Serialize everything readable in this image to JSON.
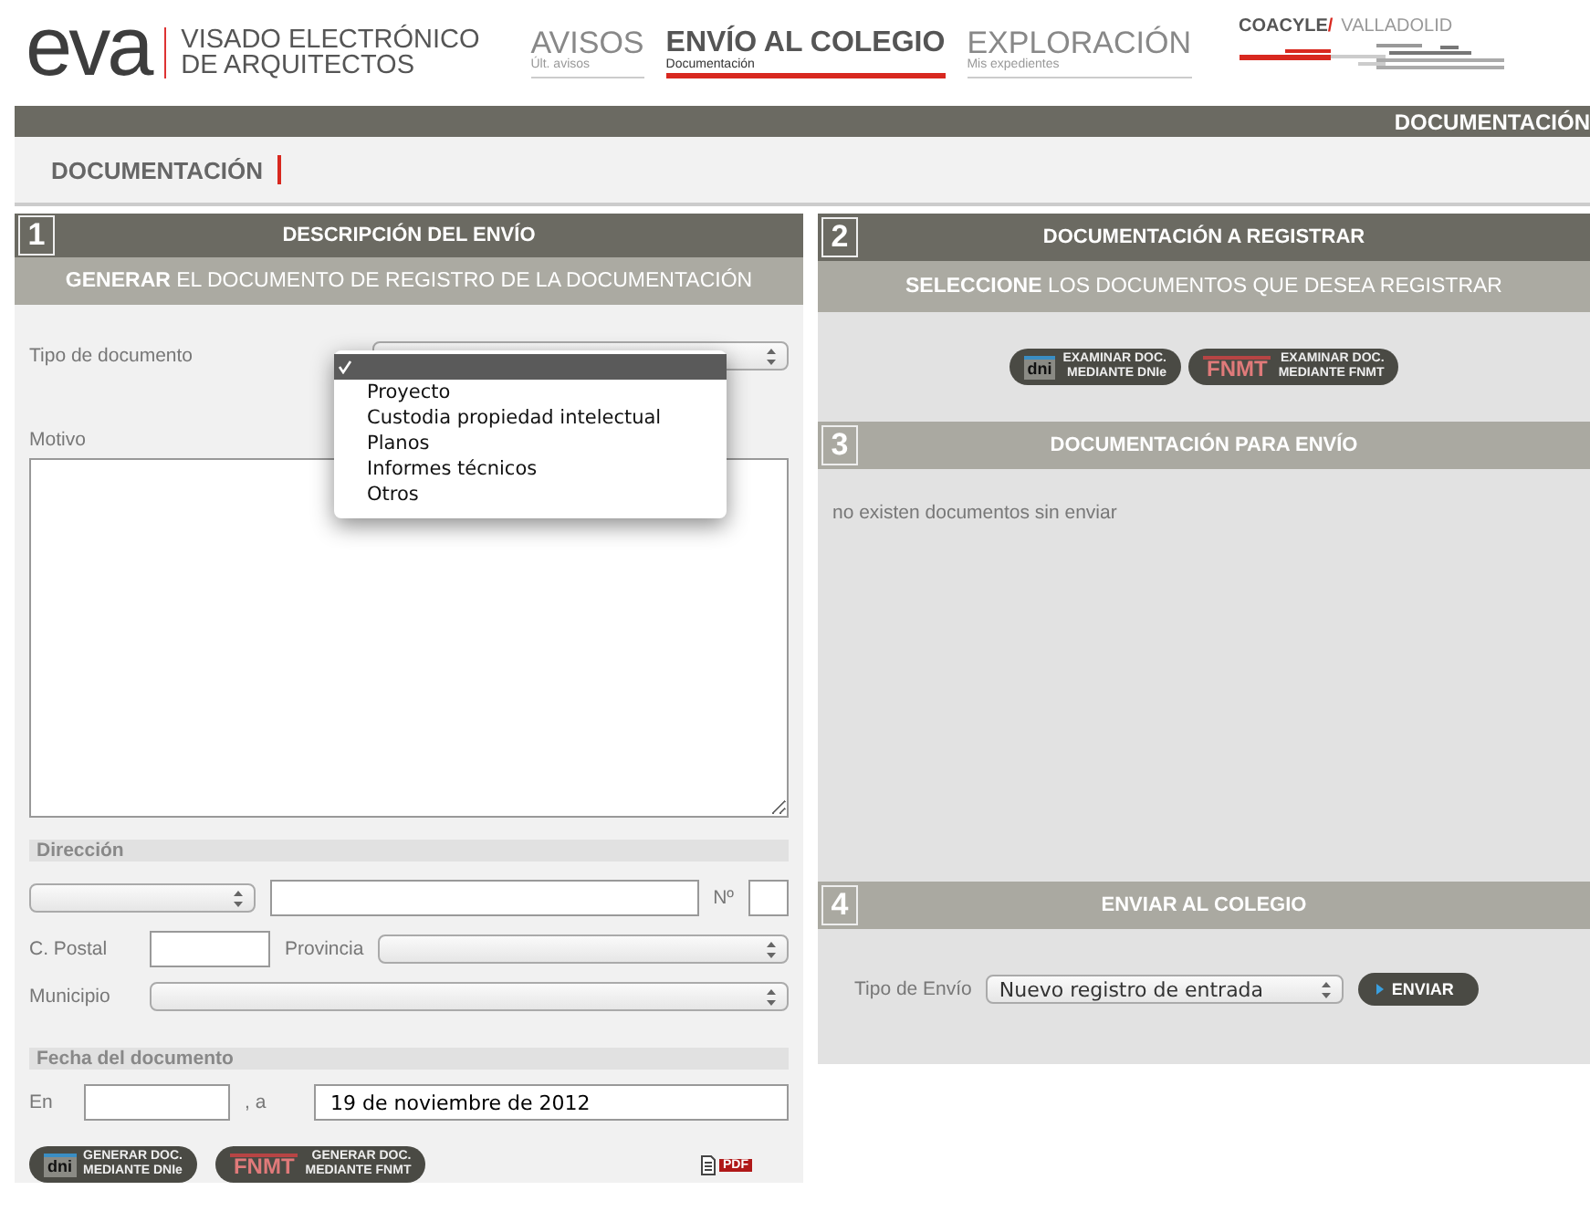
{
  "header": {
    "logo": "eva",
    "tagline": [
      "VISADO ELECTRÓNICO",
      "DE ARQUITECTOS"
    ],
    "nav": [
      {
        "title": "AVISOS",
        "subtitle": "Últ. avisos",
        "selected": false
      },
      {
        "title": "ENVÍO AL COLEGIO",
        "subtitle": "Documentación",
        "selected": true
      },
      {
        "title": "EXPLORACIÓN",
        "subtitle": "Mis expedientes",
        "selected": false
      }
    ],
    "college": {
      "name": "COACYLE/",
      "city": "VALLADOLID"
    }
  },
  "breadcrumb_bar": "DOCUMENTACIÓN",
  "page_title": "DOCUMENTACIÓN",
  "left_panel": {
    "number": "1",
    "title": "DESCRIPCIÓN DEL ENVÍO",
    "kind": "dark",
    "subtitle": "**GENERAR** EL DOCUMENTO DE REGISTRO DE LA DOCUMENTACIÓN",
    "doc_type": {
      "label": "Tipo de documento",
      "options": [
        {
          "selected": true
        },
        {
          "label": "Proyecto",
          "selected": false
        },
        {
          "label": "Custodia propiedad intelectual",
          "selected": false
        },
        {
          "label": "Planos",
          "selected": false
        },
        {
          "label": "Informes técnicos",
          "selected": false
        },
        {
          "label": "Otros",
          "selected": false
        }
      ]
    },
    "motivo": {
      "label": "Motivo"
    },
    "address": {
      "title": "Dirección",
      "number_label": "Nº",
      "postal_label": "C. Postal",
      "province_label": "Provincia",
      "municipality_label": "Municipio"
    },
    "date": {
      "title": "Fecha del documento",
      "place_label": "En",
      "date_label": ", a",
      "value": "19 de noviembre de 2012"
    },
    "buttons": [
      {
        "kind": "dnie",
        "logo": "dni",
        "lines": [
          "GENERAR DOC.",
          "MEDIANTE DNIe"
        ]
      },
      {
        "kind": "fnmt",
        "logo": "FNMT",
        "lines": [
          "GENERAR DOC.",
          "MEDIANTE FNMT"
        ]
      }
    ],
    "pdf_label": "PDF"
  },
  "right_sections": [
    {
      "number": "2",
      "title": "DOCUMENTACIÓN A REGISTRAR",
      "kind": "dark",
      "subtitle": "**SELECCIONE** LOS DOCUMENTOS QUE DESEA REGISTRAR",
      "buttons": [
        {
          "kind": "dnie",
          "logo": "dni",
          "lines": [
            "EXAMINAR DOC.",
            "MEDIANTE DNIe"
          ]
        },
        {
          "kind": "fnmt",
          "logo": "FNMT",
          "lines": [
            "EXAMINAR DOC.",
            "MEDIANTE FNMT"
          ]
        }
      ]
    },
    {
      "number": "3",
      "title": "DOCUMENTACIÓN PARA ENVÍO",
      "kind": "light",
      "message": "no existen documentos sin enviar"
    },
    {
      "number": "4",
      "title": "ENVIAR AL COLEGIO",
      "kind": "light",
      "send_type_label": "Tipo de Envío",
      "send_type_value": "Nuevo registro de entrada",
      "send_button": "ENVIAR"
    }
  ]
}
